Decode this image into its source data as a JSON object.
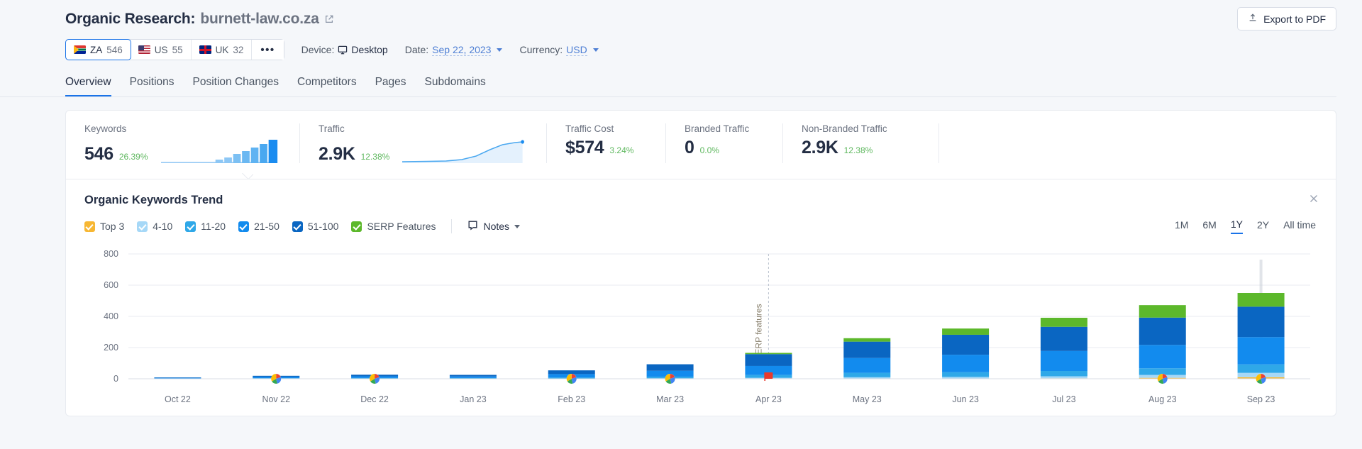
{
  "header": {
    "title_prefix": "Organic Research:",
    "domain": "burnett-law.co.za",
    "external_link_icon": "external-link-icon",
    "export_label": "Export to PDF",
    "export_icon": "upload-icon"
  },
  "filters": {
    "databases": [
      {
        "code": "ZA",
        "count": "546",
        "flag": "za-flag-icon",
        "active": true
      },
      {
        "code": "US",
        "count": "55",
        "flag": "us-flag-icon",
        "active": false
      },
      {
        "code": "UK",
        "count": "32",
        "flag": "uk-flag-icon",
        "active": false
      }
    ],
    "more_label": "•••",
    "device_label": "Device:",
    "device_value": "Desktop",
    "device_icon": "monitor-icon",
    "date_label": "Date:",
    "date_value": "Sep 22, 2023",
    "currency_label": "Currency:",
    "currency_value": "USD"
  },
  "tabs": [
    {
      "label": "Overview",
      "active": true
    },
    {
      "label": "Positions",
      "active": false
    },
    {
      "label": "Position Changes",
      "active": false
    },
    {
      "label": "Competitors",
      "active": false
    },
    {
      "label": "Pages",
      "active": false
    },
    {
      "label": "Subdomains",
      "active": false
    }
  ],
  "metrics": [
    {
      "label": "Keywords",
      "value": "546",
      "change": "26.39%"
    },
    {
      "label": "Traffic",
      "value": "2.9K",
      "change": "12.38%"
    },
    {
      "label": "Traffic Cost",
      "value": "$574",
      "change": "3.24%"
    },
    {
      "label": "Branded Traffic",
      "value": "0",
      "change": "0.0%"
    },
    {
      "label": "Non-Branded Traffic",
      "value": "2.9K",
      "change": "12.38%"
    }
  ],
  "trend_panel": {
    "title": "Organic Keywords Trend",
    "close_icon": "close-icon",
    "notes_label": "Notes",
    "notes_icon": "note-icon",
    "legend": [
      {
        "label": "Top 3",
        "color": "#f7b733",
        "checked": true
      },
      {
        "label": "4-10",
        "color": "#a6d8f7",
        "checked": true
      },
      {
        "label": "11-20",
        "color": "#2fa8e8",
        "checked": true
      },
      {
        "label": "21-50",
        "color": "#128bee",
        "checked": true
      },
      {
        "label": "51-100",
        "color": "#0a66c2",
        "checked": true
      },
      {
        "label": "SERP Features",
        "color": "#5cb82b",
        "checked": true
      }
    ],
    "ranges": [
      {
        "label": "1M",
        "active": false
      },
      {
        "label": "6M",
        "active": false
      },
      {
        "label": "1Y",
        "active": true
      },
      {
        "label": "2Y",
        "active": false
      },
      {
        "label": "All time",
        "active": false
      }
    ],
    "annotation_label": "SERP features"
  },
  "chart_data": {
    "type": "bar",
    "title": "Organic Keywords Trend",
    "xlabel": "",
    "ylabel": "",
    "ylim": [
      0,
      800
    ],
    "yticks": [
      0,
      200,
      400,
      600,
      800
    ],
    "grid": true,
    "stacked": true,
    "legend_position": "top-left",
    "categories": [
      "Oct 22",
      "Nov 22",
      "Dec 22",
      "Jan 23",
      "Feb 23",
      "Mar 23",
      "Apr 23",
      "May 23",
      "Jun 23",
      "Jul 23",
      "Aug 23",
      "Sep 23"
    ],
    "series": [
      {
        "name": "Top 3",
        "color": "#f7b733",
        "values": [
          0,
          0,
          0,
          0,
          0,
          0,
          1,
          2,
          2,
          3,
          6,
          10
        ]
      },
      {
        "name": "4-10",
        "color": "#a6d8f7",
        "values": [
          0,
          1,
          1,
          1,
          2,
          3,
          5,
          8,
          10,
          13,
          19,
          28
        ]
      },
      {
        "name": "11-20",
        "color": "#2fa8e8",
        "values": [
          2,
          3,
          4,
          4,
          6,
          10,
          18,
          28,
          30,
          34,
          42,
          54
        ]
      },
      {
        "name": "21-50",
        "color": "#128bee",
        "values": [
          4,
          8,
          11,
          10,
          22,
          38,
          58,
          95,
          112,
          128,
          150,
          175
        ]
      },
      {
        "name": "51-100",
        "color": "#0a66c2",
        "values": [
          3,
          7,
          10,
          10,
          24,
          42,
          76,
          105,
          128,
          155,
          175,
          195
        ]
      },
      {
        "name": "SERP Features",
        "color": "#5cb82b",
        "values": [
          0,
          0,
          0,
          0,
          0,
          0,
          8,
          22,
          40,
          58,
          80,
          88
        ]
      }
    ],
    "totals": [
      9,
      19,
      26,
      25,
      54,
      93,
      166,
      260,
      322,
      391,
      472,
      550
    ],
    "markers": [
      {
        "category": "Nov 22",
        "type": "google-update-icon"
      },
      {
        "category": "Dec 22",
        "type": "google-update-icon"
      },
      {
        "category": "Feb 23",
        "type": "google-update-icon"
      },
      {
        "category": "Mar 23",
        "type": "google-update-icon"
      },
      {
        "category": "Apr 23",
        "type": "note-flag-icon"
      },
      {
        "category": "Aug 23",
        "type": "google-update-icon"
      },
      {
        "category": "Sep 23",
        "type": "google-update-icon"
      }
    ],
    "annotation": {
      "label": "SERP features",
      "category": "Apr 23"
    }
  }
}
